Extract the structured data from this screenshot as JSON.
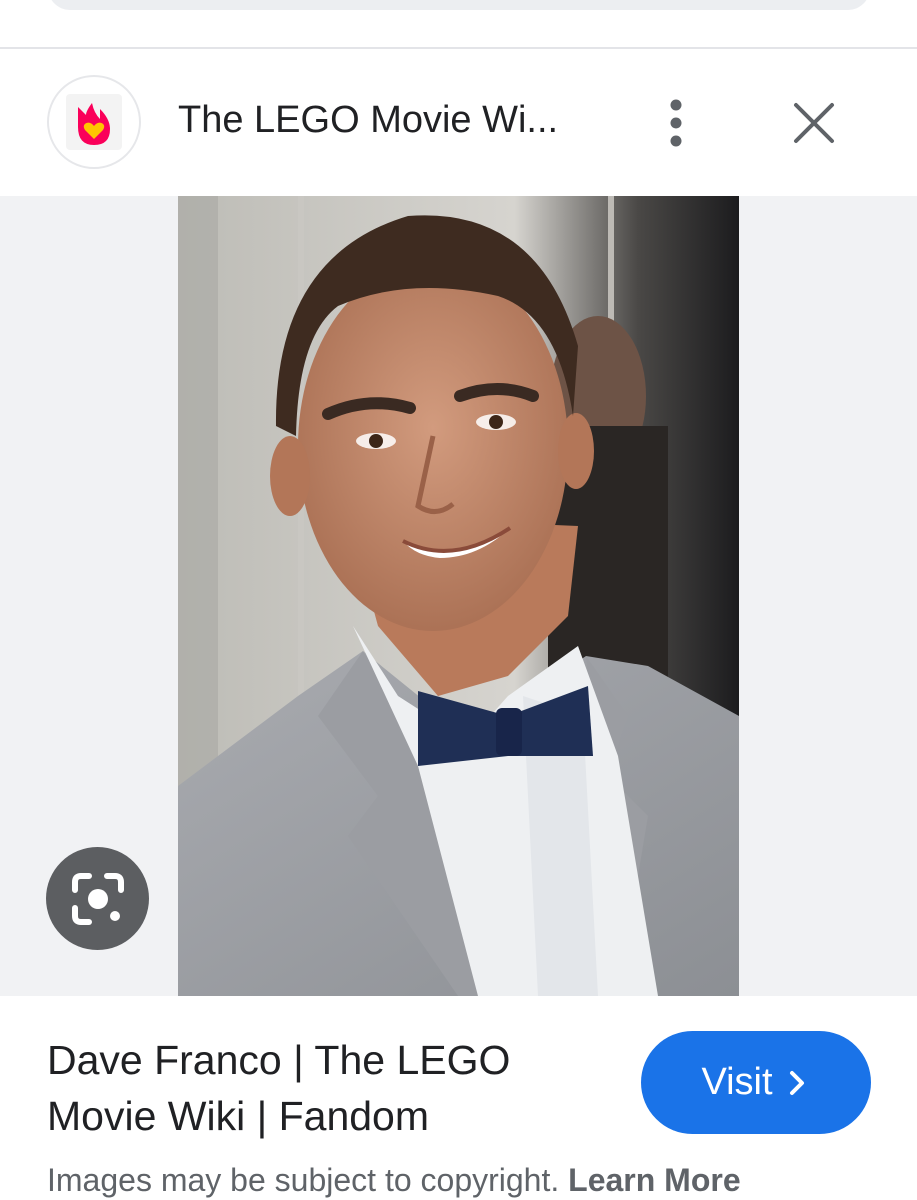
{
  "header": {
    "site_name": "The LEGO Movie Wi...",
    "site_icon": "fandom-flame-icon",
    "more_icon": "more-vert-icon",
    "close_icon": "close-icon"
  },
  "image": {
    "lens_icon": "google-lens-icon"
  },
  "result": {
    "title": "Dave Franco | The LEGO Movie Wiki | Fandom",
    "visit_label": "Visit",
    "visit_icon": "chevron-right-icon"
  },
  "footer": {
    "copyright_text": "Images may be subject to copyright.",
    "learn_more": "Learn More"
  },
  "colors": {
    "accent": "#1a73e8",
    "fandom_pink": "#fa005a",
    "fandom_yellow": "#ffc500"
  }
}
